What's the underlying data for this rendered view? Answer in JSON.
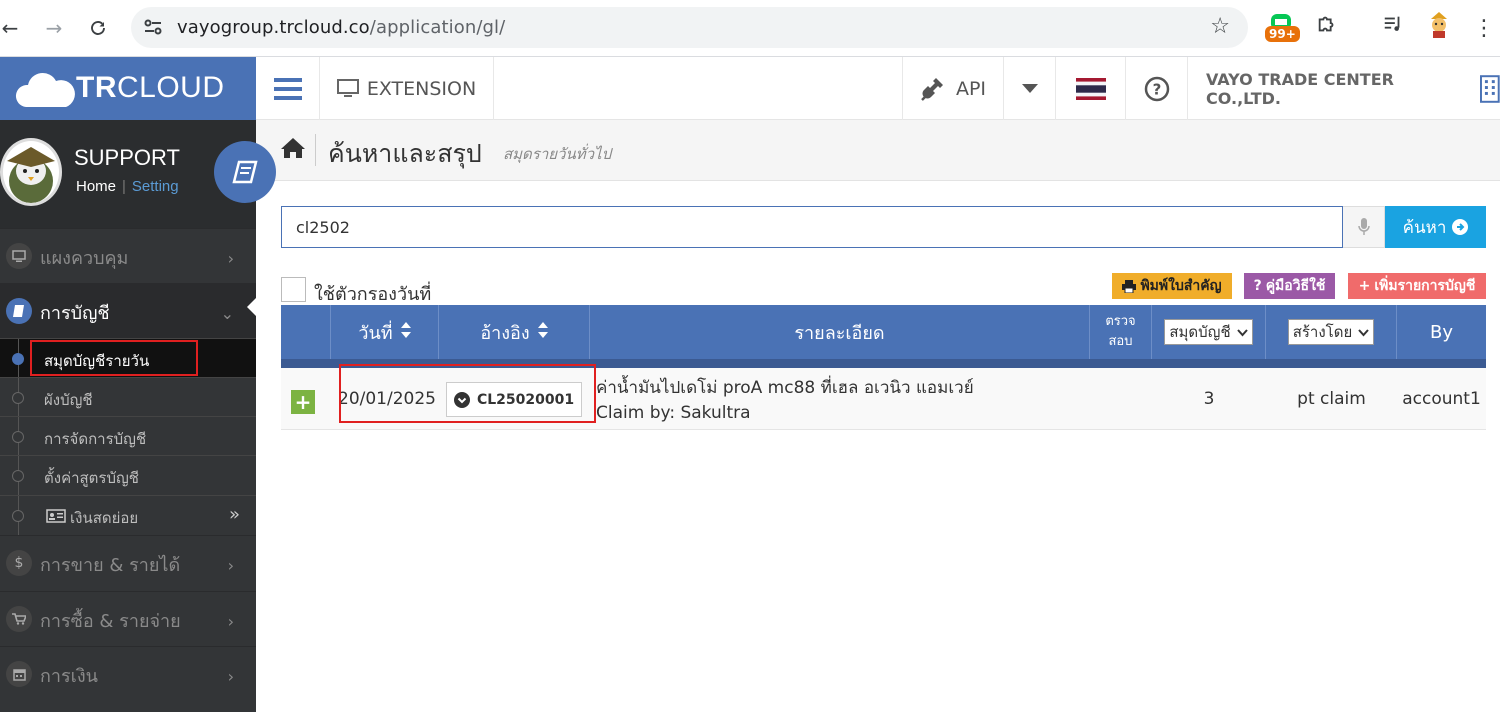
{
  "browser": {
    "url_host": "vayogroup.trcloud.co",
    "url_path": "/application/gl/",
    "badge": "99+"
  },
  "header": {
    "brand_bold": "TR",
    "brand_light": "CLOUD",
    "extension_label": "EXTENSION",
    "api_label": "API",
    "company": "VAYO TRADE CENTER CO.,LTD."
  },
  "profile": {
    "name": "SUPPORT",
    "home_link": "Home",
    "separator": "|",
    "setting_link": "Setting"
  },
  "sidebar": {
    "menu": [
      {
        "label": "แผงควบคุม",
        "icon": "monitor-icon"
      },
      {
        "label": "การบัญชี",
        "icon": "book-icon"
      },
      {
        "label": "การขาย & รายได้",
        "icon": "dollar-icon"
      },
      {
        "label": "การซื้อ & รายจ่าย",
        "icon": "cart-icon"
      },
      {
        "label": "การเงิน",
        "icon": "calendar-icon"
      }
    ],
    "submenu": [
      {
        "label": "สมุดบัญชีรายวัน"
      },
      {
        "label": "ผังบัญชี"
      },
      {
        "label": "การจัดการบัญชี"
      },
      {
        "label": "ตั้งค่าสูตรบัญชี"
      },
      {
        "label": "เงินสดย่อย"
      }
    ]
  },
  "page": {
    "title": "ค้นหาและสรุป",
    "subtitle": "สมุดรายวันทั่วไป"
  },
  "search": {
    "value": "cl2502",
    "button_label": "ค้นหา"
  },
  "filter": {
    "date_filter_label": "ใช้ตัวกรองวันที่"
  },
  "actions": {
    "print": "พิมพ์ใบสำคัญ",
    "manual": "คู่มือวิธีใช้",
    "add": "เพิ่มรายการบัญชี"
  },
  "table": {
    "headers": {
      "date": "วันที่",
      "reference": "อ้างอิง",
      "detail": "รายละเอียด",
      "check_line1": "ตรวจ",
      "check_line2": "สอบ",
      "journal_select": "สมุดบัญชี",
      "created_by_select": "สร้างโดย",
      "by": "By"
    },
    "rows": [
      {
        "date": "20/01/2025",
        "reference": "CL25020001",
        "detail_line1": "ค่าน้ำมันไปเดโม่ proA mc88 ที่เฮล อเวนิว แอมเวย์",
        "detail_line2": "Claim by: Sakultra",
        "journal": "3",
        "created_by": "pt claim",
        "by": "account1"
      }
    ]
  },
  "colors": {
    "brand_blue": "#4a72b5",
    "sidebar_bg": "#333537",
    "search_button": "#1aa3e1",
    "print_button": "#f0ad2a",
    "manual_button": "#9b59a6",
    "add_button": "#f06b6b",
    "plus_button": "#7cb342",
    "highlight_red": "#e02020"
  }
}
